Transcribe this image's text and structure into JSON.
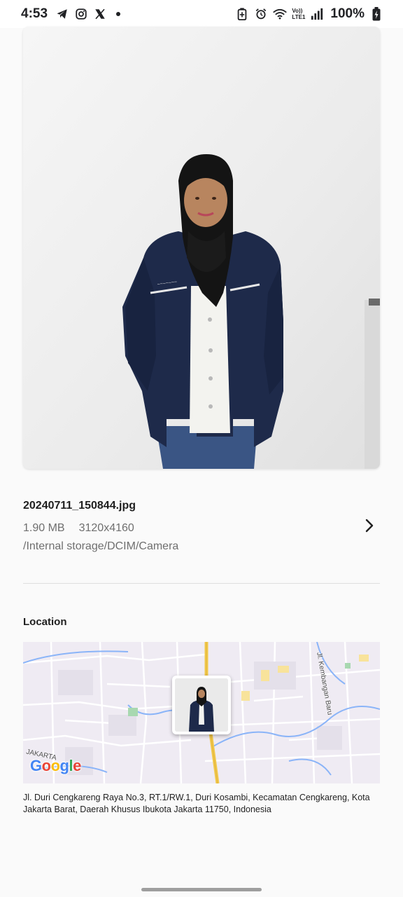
{
  "status_bar": {
    "time": "4:53",
    "left_icons": [
      "telegram-icon",
      "instagram-icon",
      "x-icon",
      "notification-dot"
    ],
    "right_icons": [
      "battery-saver-icon",
      "alarm-icon",
      "wifi-icon",
      "volte-icon",
      "signal-icon",
      "charging-battery-icon"
    ],
    "lte_top": "Vo))",
    "lte_bottom": "LTE1",
    "battery": "100%"
  },
  "photo": {
    "subject": "person-photo"
  },
  "file": {
    "name": "20240711_150844.jpg",
    "size": "1.90 MB",
    "resolution": "3120x4160",
    "path": "/Internal storage/DCIM/Camera",
    "detail_icon": "chevron-right-icon"
  },
  "location": {
    "title": "Location",
    "street_label": "Jl. Kembangan Baru",
    "area_label": "JAKARTA",
    "map_brand": "Google",
    "address": "Jl. Duri Cengkareng Raya No.3, RT.1/RW.1, Duri Kosambi, Kecamatan Cengkareng, Kota Jakarta Barat, Daerah Khusus Ibukota Jakarta 11750, Indonesia"
  },
  "colors": {
    "background": "#fafafa",
    "text_primary": "#1f1f1f",
    "text_secondary": "#6f6f6f",
    "map_road_major": "#f2c94c",
    "map_water": "#8ab4f8",
    "jacket": "#1e2a4a"
  }
}
